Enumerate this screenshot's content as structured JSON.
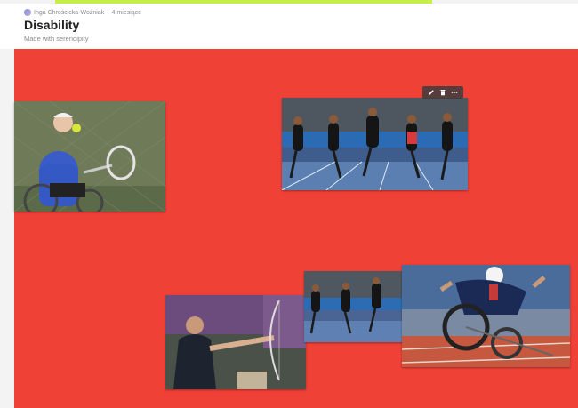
{
  "header": {
    "author": "Inga Chrościcka-Woźniak",
    "separator": "·",
    "time_ago": "4 miesiące",
    "title": "Disability",
    "subtitle": "Made with serendipity"
  },
  "canvas": {
    "background": "#ef4136",
    "images": [
      {
        "name": "wheelchair-tennis-image"
      },
      {
        "name": "sprint-race-image"
      },
      {
        "name": "archery-image"
      },
      {
        "name": "sprint-race-image-2"
      },
      {
        "name": "wheelchair-racing-image"
      }
    ]
  },
  "toolbar": {
    "icons": [
      "pencil-icon",
      "trash-icon",
      "more-icon"
    ]
  },
  "colors": {
    "accent_strip": "#c6ee4a",
    "canvas_red": "#ef4136"
  }
}
